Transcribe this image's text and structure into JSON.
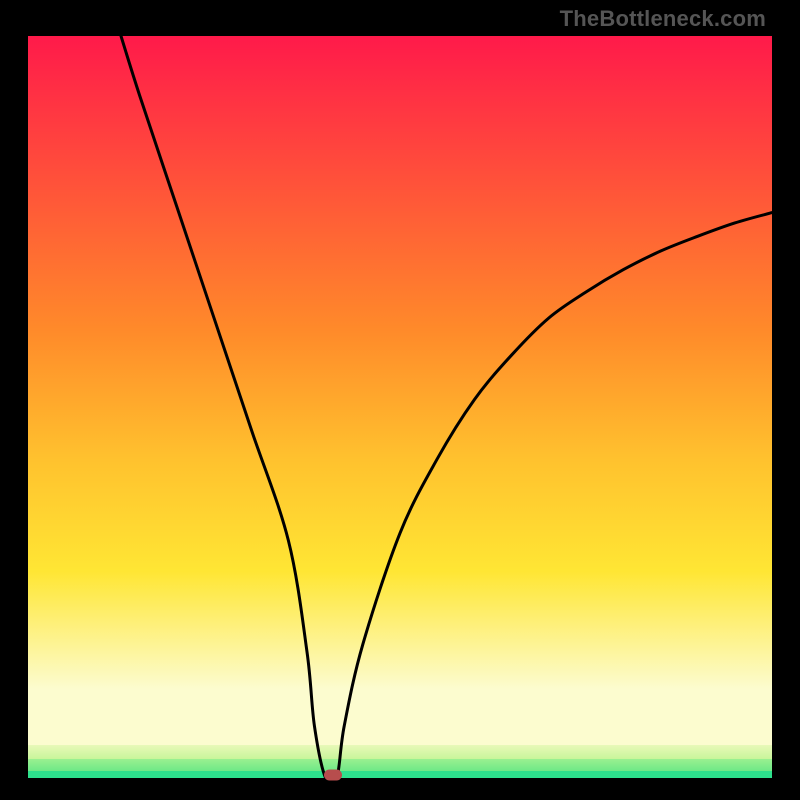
{
  "attribution": "TheBottleneck.com",
  "colors": {
    "top": "#ff1a4a",
    "mid_upper": "#ff8a2a",
    "mid": "#ffe634",
    "pale": "#fcfccf",
    "green1": "#c8f59a",
    "green2": "#6ee887",
    "green3": "#2de08c",
    "curve": "#000000",
    "marker": "#b74d4d",
    "frame": "#000000"
  },
  "chart_data": {
    "type": "line",
    "title": "",
    "xlabel": "",
    "ylabel": "",
    "xlim": [
      0,
      100
    ],
    "ylim": [
      0,
      100
    ],
    "x": [
      12.5,
      15,
      20,
      25,
      30,
      35,
      37.5,
      38.5,
      40,
      41.5,
      42.5,
      45,
      50,
      55,
      60,
      65,
      70,
      75,
      80,
      85,
      90,
      95,
      100
    ],
    "values": [
      100,
      92,
      77,
      62,
      47,
      32,
      17,
      7,
      0,
      0,
      7,
      18,
      33,
      43,
      51,
      57,
      62,
      65.5,
      68.5,
      71,
      73,
      74.8,
      76.2
    ],
    "marker": {
      "x": 41,
      "y": 0
    },
    "background_bands": [
      {
        "from_y": 99,
        "to_y": 100,
        "color": "#2de08c"
      },
      {
        "from_y": 97.5,
        "to_y": 99,
        "color": "#6ee887"
      },
      {
        "from_y": 95.5,
        "to_y": 97.5,
        "color": "#c8f59a"
      },
      {
        "from_y": 88,
        "to_y": 95.5,
        "color": "#fcfccf"
      },
      {
        "from_y": 0,
        "to_y": 88,
        "gradient": [
          "#ff1a4a",
          "#ff8a2a",
          "#ffe634",
          "#fcfccf"
        ]
      }
    ]
  }
}
